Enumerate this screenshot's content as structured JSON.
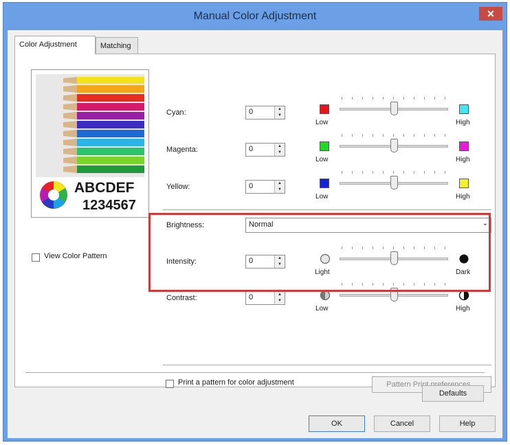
{
  "window": {
    "title": "Manual Color Adjustment",
    "close_label": "✕"
  },
  "tabs": [
    {
      "label": "Color Adjustment"
    },
    {
      "label": "Matching"
    }
  ],
  "preview": {
    "text_line1": "ABCDEF",
    "text_line2": "1234567"
  },
  "view_color_pattern": {
    "label": "View Color Pattern",
    "checked": false
  },
  "cyan": {
    "label": "Cyan:",
    "value": "0",
    "low_label": "Low",
    "high_label": "High",
    "low_color": "#e8141e",
    "high_color": "#45e4f2",
    "slider_level": 0.5
  },
  "magenta": {
    "label": "Magenta:",
    "value": "0",
    "low_label": "Low",
    "high_label": "High",
    "low_color": "#22d62a",
    "high_color": "#e41ed6",
    "slider_level": 0.5
  },
  "yellow": {
    "label": "Yellow:",
    "value": "0",
    "low_label": "Low",
    "high_label": "High",
    "low_color": "#1421d4",
    "high_color": "#f5f028",
    "slider_level": 0.5
  },
  "brightness": {
    "label": "Brightness:",
    "value": "Normal"
  },
  "intensity": {
    "label": "Intensity:",
    "value": "0",
    "low_label": "Light",
    "high_label": "Dark",
    "slider_level": 0.5
  },
  "contrast": {
    "label": "Contrast:",
    "value": "0",
    "low_label": "Low",
    "high_label": "High",
    "slider_level": 0.5
  },
  "print_pattern": {
    "label": "Print a pattern for color adjustment",
    "checked": false
  },
  "buttons": {
    "pattern_print_preferences": "Pattern Print preferences...",
    "defaults": "Defaults",
    "ok": "OK",
    "cancel": "Cancel",
    "help": "Help"
  }
}
